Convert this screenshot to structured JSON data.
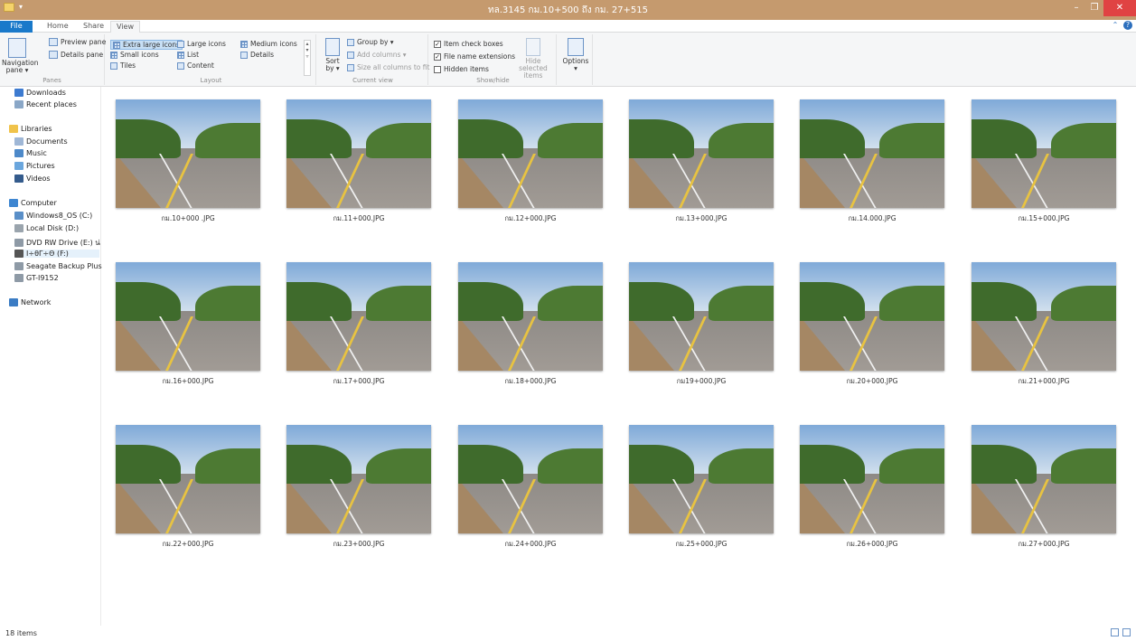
{
  "window": {
    "title": "ทล.3145 กม.10+500 ถึง กม. 27+515",
    "accent": "#c59a6e",
    "close_glyph": "✕",
    "minimize_glyph": "–",
    "maximize_glyph": "❐"
  },
  "tabs": [
    "File",
    "Home",
    "Share",
    "View"
  ],
  "ribbon": {
    "panes": {
      "navigation_pane": "Navigation pane ▾",
      "preview_pane": "Preview pane",
      "details_pane": "Details pane",
      "label": "Panes"
    },
    "layout": {
      "extra_large": "Extra large icons",
      "large": "Large icons",
      "medium": "Medium icons",
      "small": "Small icons",
      "list": "List",
      "details": "Details",
      "tiles": "Tiles",
      "content": "Content",
      "label": "Layout"
    },
    "current_view": {
      "sort_by": "Sort by ▾",
      "group_by": "Group by ▾",
      "add_columns": "Add columns ▾",
      "size_all": "Size all columns to fit",
      "label": "Current view"
    },
    "show_hide": {
      "item_check_boxes": "Item check boxes",
      "file_name_extensions": "File name extensions",
      "hidden_items": "Hidden items",
      "hide_selected": "Hide selected items",
      "label": "Show/hide"
    },
    "options": "Options ▾"
  },
  "nav": {
    "items": [
      {
        "label": "Downloads",
        "color": "#3d7bd0"
      },
      {
        "label": "Recent places",
        "color": "#8aa7c7"
      },
      {
        "label": "Libraries",
        "color": "#f0c34b"
      },
      {
        "label": "Documents",
        "color": "#9fb7d6"
      },
      {
        "label": "Music",
        "color": "#4d89c9"
      },
      {
        "label": "Pictures",
        "color": "#6aa6dd"
      },
      {
        "label": "Videos",
        "color": "#345b8c"
      },
      {
        "label": "Computer",
        "color": "#3e86d1"
      },
      {
        "label": "Windows8_OS (C:)",
        "color": "#5a8fc8"
      },
      {
        "label": "Local Disk (D:)",
        "color": "#9aa4ad"
      },
      {
        "label": "DVD RW Drive (E:) น่",
        "color": "#8e9aa6"
      },
      {
        "label": "I÷θΓ÷Θ (F:)",
        "color": "#555555"
      },
      {
        "label": "Seagate Backup Plus",
        "color": "#8e9aa6"
      },
      {
        "label": "GT-I9152",
        "color": "#8e9aa6"
      },
      {
        "label": "Network",
        "color": "#3b7cc4"
      }
    ]
  },
  "files": [
    "กม.10+000 .JPG",
    "กม.11+000.JPG",
    "กม.12+000.JPG",
    "กม.13+000.JPG",
    "กม.14.000.JPG",
    "กม.15+000.JPG",
    "กม.16+000.JPG",
    "กม.17+000.JPG",
    "กม.18+000.JPG",
    "กม19+000.JPG",
    "กม.20+000.JPG",
    "กม.21+000.JPG",
    "กม.22+000.JPG",
    "กม.23+000.JPG",
    "กม.24+000.JPG",
    "กม.25+000.JPG",
    "กม.26+000.JPG",
    "กม.27+000.JPG"
  ],
  "status": {
    "count": "18 items"
  }
}
